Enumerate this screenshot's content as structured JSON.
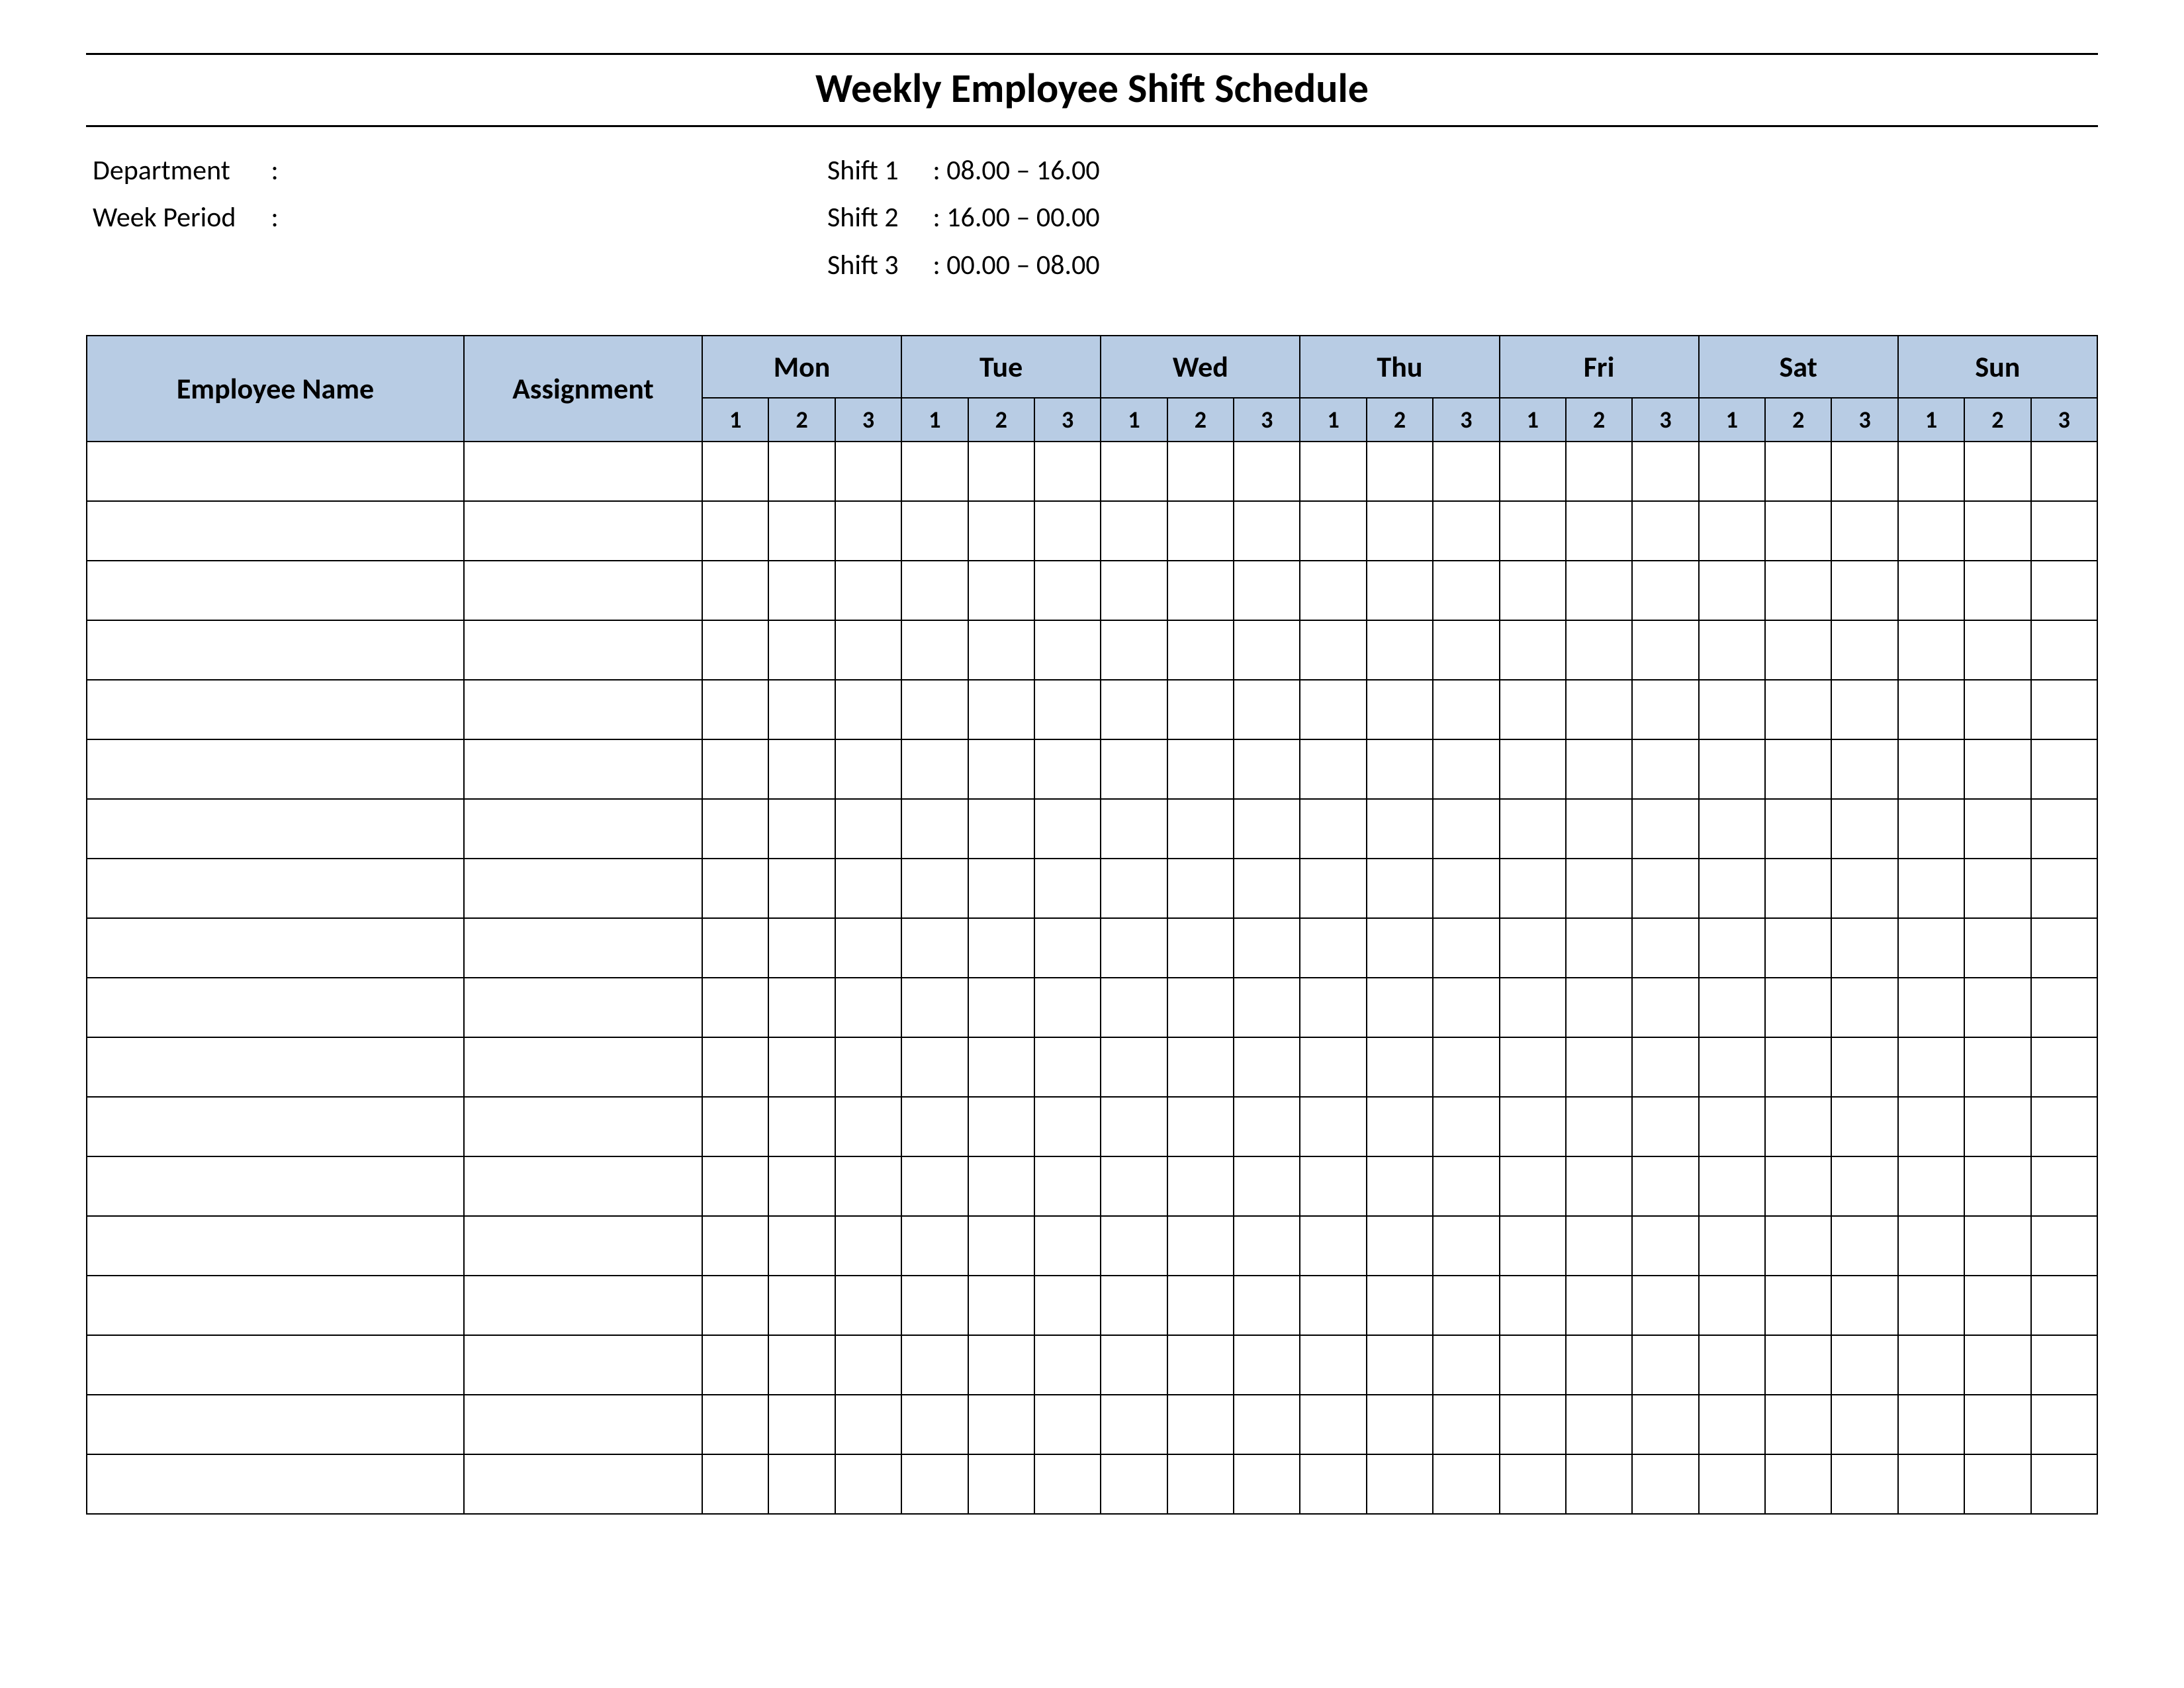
{
  "title": "Weekly Employee Shift Schedule",
  "meta": {
    "department_label": "Department",
    "department_value": "",
    "week_period_label": "Week  Period",
    "week_period_value": "",
    "shifts": [
      {
        "label": "Shift 1",
        "time": "08.00  – 16.00"
      },
      {
        "label": "Shift 2",
        "time": "16.00  – 00.00"
      },
      {
        "label": "Shift 3",
        "time": "00.00  – 08.00"
      }
    ]
  },
  "table": {
    "employee_header": "Employee Name",
    "assignment_header": "Assignment",
    "days": [
      "Mon",
      "Tue",
      "Wed",
      "Thu",
      "Fri",
      "Sat",
      "Sun"
    ],
    "shift_numbers": [
      "1",
      "2",
      "3"
    ],
    "rows": [
      {
        "name": "",
        "assignment": "",
        "cells": [
          "",
          "",
          "",
          "",
          "",
          "",
          "",
          "",
          "",
          "",
          "",
          "",
          "",
          "",
          "",
          "",
          "",
          "",
          "",
          "",
          ""
        ]
      },
      {
        "name": "",
        "assignment": "",
        "cells": [
          "",
          "",
          "",
          "",
          "",
          "",
          "",
          "",
          "",
          "",
          "",
          "",
          "",
          "",
          "",
          "",
          "",
          "",
          "",
          "",
          ""
        ]
      },
      {
        "name": "",
        "assignment": "",
        "cells": [
          "",
          "",
          "",
          "",
          "",
          "",
          "",
          "",
          "",
          "",
          "",
          "",
          "",
          "",
          "",
          "",
          "",
          "",
          "",
          "",
          ""
        ]
      },
      {
        "name": "",
        "assignment": "",
        "cells": [
          "",
          "",
          "",
          "",
          "",
          "",
          "",
          "",
          "",
          "",
          "",
          "",
          "",
          "",
          "",
          "",
          "",
          "",
          "",
          "",
          ""
        ]
      },
      {
        "name": "",
        "assignment": "",
        "cells": [
          "",
          "",
          "",
          "",
          "",
          "",
          "",
          "",
          "",
          "",
          "",
          "",
          "",
          "",
          "",
          "",
          "",
          "",
          "",
          "",
          ""
        ]
      },
      {
        "name": "",
        "assignment": "",
        "cells": [
          "",
          "",
          "",
          "",
          "",
          "",
          "",
          "",
          "",
          "",
          "",
          "",
          "",
          "",
          "",
          "",
          "",
          "",
          "",
          "",
          ""
        ]
      },
      {
        "name": "",
        "assignment": "",
        "cells": [
          "",
          "",
          "",
          "",
          "",
          "",
          "",
          "",
          "",
          "",
          "",
          "",
          "",
          "",
          "",
          "",
          "",
          "",
          "",
          "",
          ""
        ]
      },
      {
        "name": "",
        "assignment": "",
        "cells": [
          "",
          "",
          "",
          "",
          "",
          "",
          "",
          "",
          "",
          "",
          "",
          "",
          "",
          "",
          "",
          "",
          "",
          "",
          "",
          "",
          ""
        ]
      },
      {
        "name": "",
        "assignment": "",
        "cells": [
          "",
          "",
          "",
          "",
          "",
          "",
          "",
          "",
          "",
          "",
          "",
          "",
          "",
          "",
          "",
          "",
          "",
          "",
          "",
          "",
          ""
        ]
      },
      {
        "name": "",
        "assignment": "",
        "cells": [
          "",
          "",
          "",
          "",
          "",
          "",
          "",
          "",
          "",
          "",
          "",
          "",
          "",
          "",
          "",
          "",
          "",
          "",
          "",
          "",
          ""
        ]
      },
      {
        "name": "",
        "assignment": "",
        "cells": [
          "",
          "",
          "",
          "",
          "",
          "",
          "",
          "",
          "",
          "",
          "",
          "",
          "",
          "",
          "",
          "",
          "",
          "",
          "",
          "",
          ""
        ]
      },
      {
        "name": "",
        "assignment": "",
        "cells": [
          "",
          "",
          "",
          "",
          "",
          "",
          "",
          "",
          "",
          "",
          "",
          "",
          "",
          "",
          "",
          "",
          "",
          "",
          "",
          "",
          ""
        ]
      },
      {
        "name": "",
        "assignment": "",
        "cells": [
          "",
          "",
          "",
          "",
          "",
          "",
          "",
          "",
          "",
          "",
          "",
          "",
          "",
          "",
          "",
          "",
          "",
          "",
          "",
          "",
          ""
        ]
      },
      {
        "name": "",
        "assignment": "",
        "cells": [
          "",
          "",
          "",
          "",
          "",
          "",
          "",
          "",
          "",
          "",
          "",
          "",
          "",
          "",
          "",
          "",
          "",
          "",
          "",
          "",
          ""
        ]
      },
      {
        "name": "",
        "assignment": "",
        "cells": [
          "",
          "",
          "",
          "",
          "",
          "",
          "",
          "",
          "",
          "",
          "",
          "",
          "",
          "",
          "",
          "",
          "",
          "",
          "",
          "",
          ""
        ]
      },
      {
        "name": "",
        "assignment": "",
        "cells": [
          "",
          "",
          "",
          "",
          "",
          "",
          "",
          "",
          "",
          "",
          "",
          "",
          "",
          "",
          "",
          "",
          "",
          "",
          "",
          "",
          ""
        ]
      },
      {
        "name": "",
        "assignment": "",
        "cells": [
          "",
          "",
          "",
          "",
          "",
          "",
          "",
          "",
          "",
          "",
          "",
          "",
          "",
          "",
          "",
          "",
          "",
          "",
          "",
          "",
          ""
        ]
      },
      {
        "name": "",
        "assignment": "",
        "cells": [
          "",
          "",
          "",
          "",
          "",
          "",
          "",
          "",
          "",
          "",
          "",
          "",
          "",
          "",
          "",
          "",
          "",
          "",
          "",
          "",
          ""
        ]
      }
    ]
  }
}
